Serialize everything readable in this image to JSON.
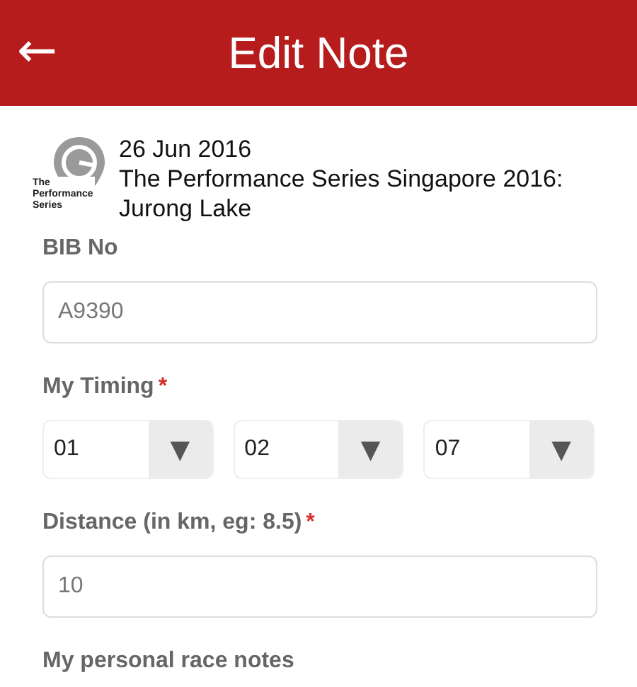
{
  "header": {
    "back_icon": "←",
    "title": "Edit Note"
  },
  "event": {
    "logo_text": [
      "The",
      "Performance",
      "Series"
    ],
    "date": "26 Jun 2016",
    "name": "The Performance Series Singapore 2016: Jurong Lake"
  },
  "fields": [
    {
      "kind": "input",
      "label": "BIB No",
      "value": "A9390"
    },
    {
      "kind": "selects",
      "label": "My Timing",
      "required_mark": "*",
      "selects": [
        {
          "value": "01",
          "arrow": "▼"
        },
        {
          "value": "02",
          "arrow": "▼"
        },
        {
          "value": "07",
          "arrow": "▼"
        }
      ]
    },
    {
      "kind": "input",
      "label": "Distance (in km, eg: 8.5)",
      "required_mark": "*",
      "value": "10"
    },
    {
      "kind": "label",
      "label": "My personal race notes"
    }
  ]
}
